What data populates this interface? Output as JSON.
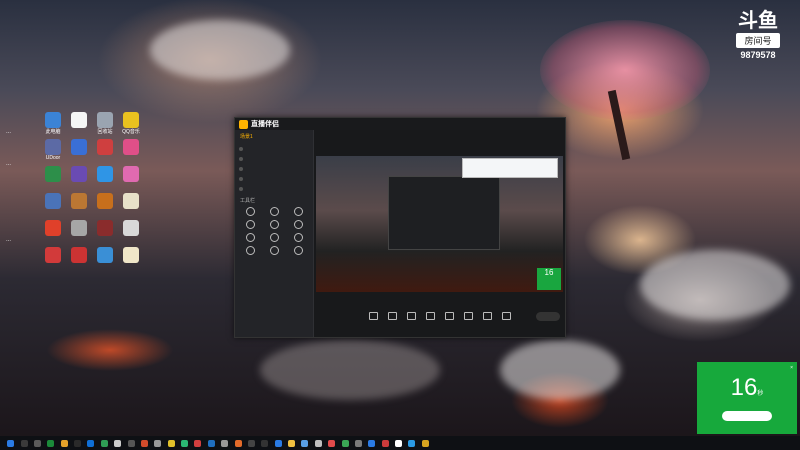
{
  "brand": {
    "logo": "斗鱼",
    "sub": "房间号",
    "room": "9879578"
  },
  "desktop": {
    "icons": [
      {
        "label": "此电脑",
        "color": "#3b83d6"
      },
      {
        "label": "",
        "color": "#f5f5f5"
      },
      {
        "label": "回收站",
        "color": "#9aa4b1"
      },
      {
        "label": "QQ音乐",
        "color": "#e9c11f"
      },
      {
        "label": "UDoor",
        "color": "#5c6aa5"
      },
      {
        "label": "",
        "color": "#3a6fd6"
      },
      {
        "label": "",
        "color": "#cf3f3f"
      },
      {
        "label": "",
        "color": "#e04f88"
      },
      {
        "label": "",
        "color": "#2d8f4a"
      },
      {
        "label": "",
        "color": "#6a4bb3"
      },
      {
        "label": "",
        "color": "#2f95e6"
      },
      {
        "label": "",
        "color": "#e06ab0"
      },
      {
        "label": "",
        "color": "#4a73b8"
      },
      {
        "label": "",
        "color": "#bb7733"
      },
      {
        "label": "",
        "color": "#c76f1c"
      },
      {
        "label": "",
        "color": "#e8e0c8"
      },
      {
        "label": "",
        "color": "#e0402a"
      },
      {
        "label": "",
        "color": "#a6a6a6"
      },
      {
        "label": "",
        "color": "#8a2c2c"
      },
      {
        "label": "",
        "color": "#d8d8d8"
      },
      {
        "label": "",
        "color": "#d23a3a"
      },
      {
        "label": "",
        "color": "#c33"
      },
      {
        "label": "",
        "color": "#3a8fd6"
      },
      {
        "label": "",
        "color": "#f0e6c8"
      }
    ],
    "text1": "...",
    "text2": "...",
    "text3": "..."
  },
  "app": {
    "title": "直播伴侣",
    "tabs": [
      "场景1",
      "",
      ""
    ],
    "scenes": [
      "",
      "",
      "",
      "",
      ""
    ],
    "tools_title": "工具栏",
    "tools": [
      "",
      "",
      "",
      "",
      "",
      "",
      "",
      "",
      "",
      "",
      "",
      ""
    ],
    "footer": "",
    "main_title": "",
    "main_sub": "",
    "tooltip": "",
    "toolbar": [
      "",
      "",
      "",
      "",
      "",
      "",
      "",
      ""
    ],
    "go_live": ""
  },
  "timer": {
    "header": "",
    "value": "16",
    "unit": "秒",
    "line": "",
    "button": "",
    "color": "#17a93c"
  },
  "taskbar": {
    "time": "",
    "date": "",
    "icon_colors": [
      "#2a7be4",
      "#3a3a3a",
      "#5b5b5b",
      "#1b8a3a",
      "#e4a12a",
      "#2a2a2a",
      "#0f6fd6",
      "#2f9e55",
      "#ccc",
      "#555",
      "#d24b2b",
      "#999",
      "#e0c02a",
      "#2bb673",
      "#d23f3f",
      "#1f6fc0",
      "#999",
      "#e36b2a",
      "#444",
      "#333",
      "#2a7be4",
      "#f0c040",
      "#5aa0e6",
      "#c0c0c0",
      "#e24b4b",
      "#3aa655",
      "#7a7a7a",
      "#2a7be4",
      "#cc3b3b",
      "#fff",
      "#2a9ae4",
      "#d8a520"
    ]
  }
}
